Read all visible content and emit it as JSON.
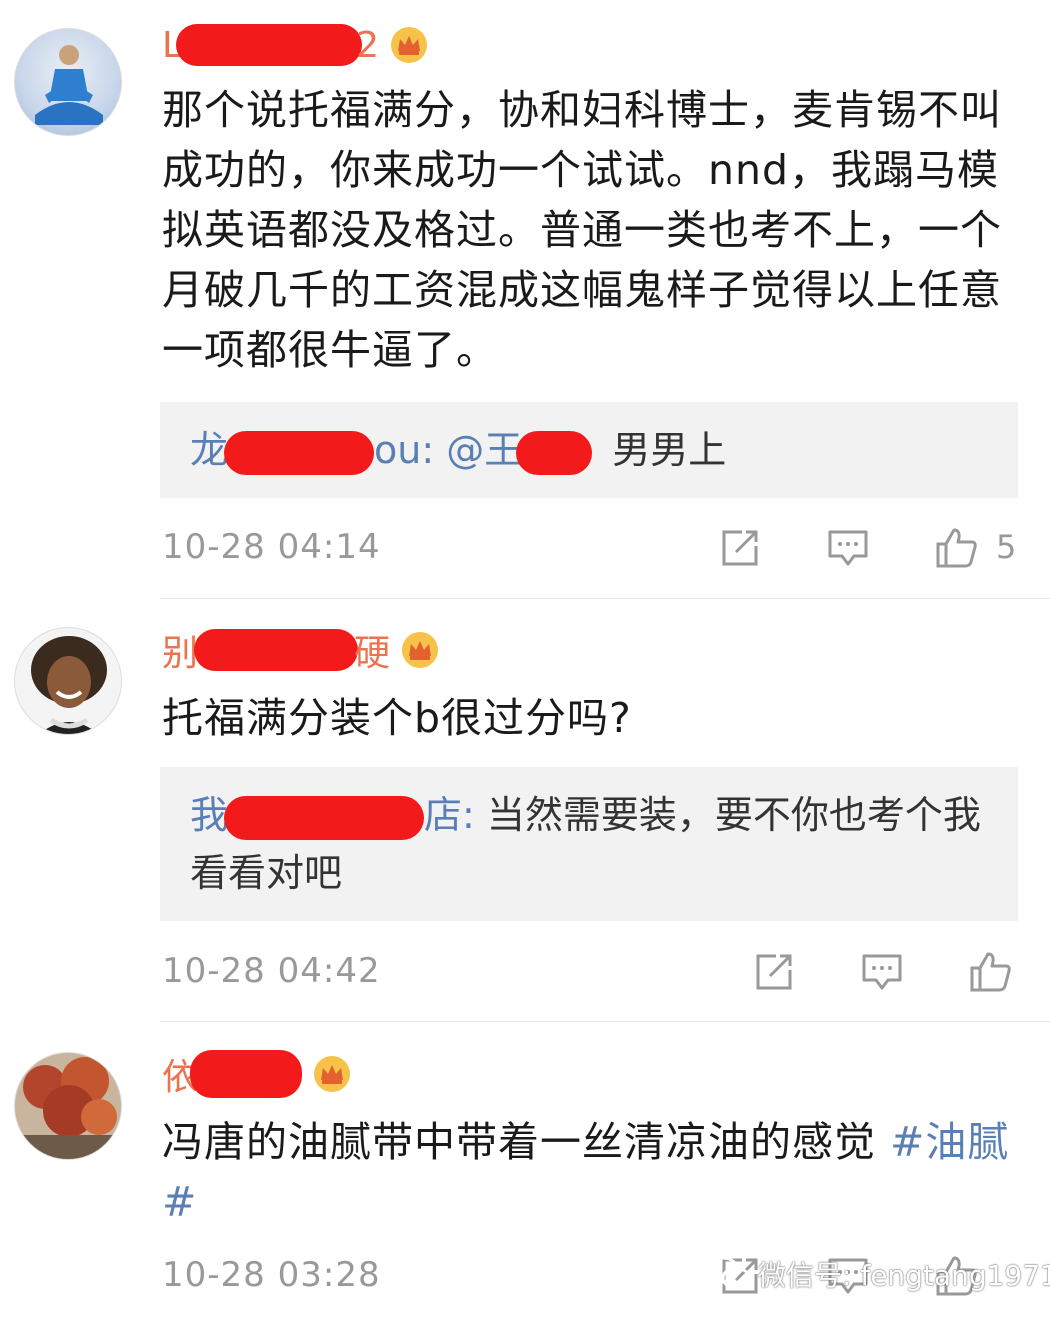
{
  "comments": [
    {
      "name_prefix": "L",
      "name_suffix": "2",
      "text": "那个说托福满分，协和妇科博士，麦肯锡不叫成功的，你来成功一个试试。nnd，我蹋马模拟英语都没及格过。普通一类也考不上，一个月破几千的工资混成这幅鬼样子觉得以上任意一项都很牛逼了。",
      "reply": {
        "who_prefix": "龙",
        "who_mid": "ou: @王",
        "text": "男男上"
      },
      "time": "10-28 04:14",
      "likes": "5"
    },
    {
      "name_prefix": "别",
      "name_suffix": "硬",
      "text": "托福满分装个b很过分吗?",
      "reply": {
        "who_prefix": "我",
        "who_suffix": "店: ",
        "text": "当然需要装，要不你也考个我看看对吧"
      },
      "time": "10-28 04:42",
      "likes": ""
    },
    {
      "name_prefix": "依",
      "name_suffix": "",
      "text": "冯唐的油腻带中带着一丝清凉油的感觉 ",
      "hashtag": "#油腻#",
      "time": "10-28 03:28"
    }
  ],
  "watermark": "微信号: fengtang1971",
  "colors": {
    "name": "#eb7350",
    "link": "#5a7fb4",
    "redaction": "#f21a1a",
    "reply_bg": "#f2f2f2"
  },
  "icons": [
    "forward-icon",
    "comment-icon",
    "like-icon",
    "crown-icon",
    "wechat-icon"
  ]
}
